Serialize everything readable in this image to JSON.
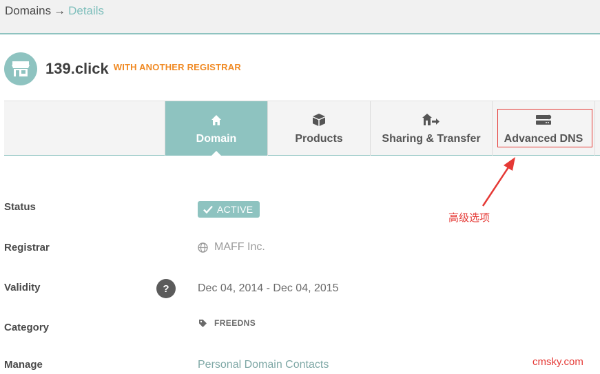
{
  "breadcrumb": {
    "root": "Domains",
    "separator": "→",
    "current": "Details"
  },
  "domain": {
    "name": "139.click",
    "badge": "WITH ANOTHER REGISTRAR",
    "icon": "storefront-icon"
  },
  "tabs": [
    {
      "label": "Domain",
      "icon": "home-icon",
      "active": true
    },
    {
      "label": "Products",
      "icon": "box-icon",
      "active": false
    },
    {
      "label": "Sharing & Transfer",
      "icon": "transfer-icon",
      "active": false
    },
    {
      "label": "Advanced DNS",
      "icon": "server-icon",
      "active": false
    }
  ],
  "annotation": {
    "label": "高级选项"
  },
  "details": {
    "status": {
      "label": "Status",
      "value": "ACTIVE"
    },
    "registrar": {
      "label": "Registrar",
      "value": "MAFF Inc."
    },
    "validity": {
      "label": "Validity",
      "help": "?",
      "value": "Dec 04, 2014 - Dec 04, 2015"
    },
    "category": {
      "label": "Category",
      "value": "FREEDNS"
    },
    "manage": {
      "label": "Manage",
      "value": "Personal Domain Contacts"
    }
  },
  "watermark": "cmsky.com",
  "colors": {
    "accent": "#8ec3c0",
    "badge_orange": "#f08a24",
    "annotation_red": "#e53935"
  }
}
